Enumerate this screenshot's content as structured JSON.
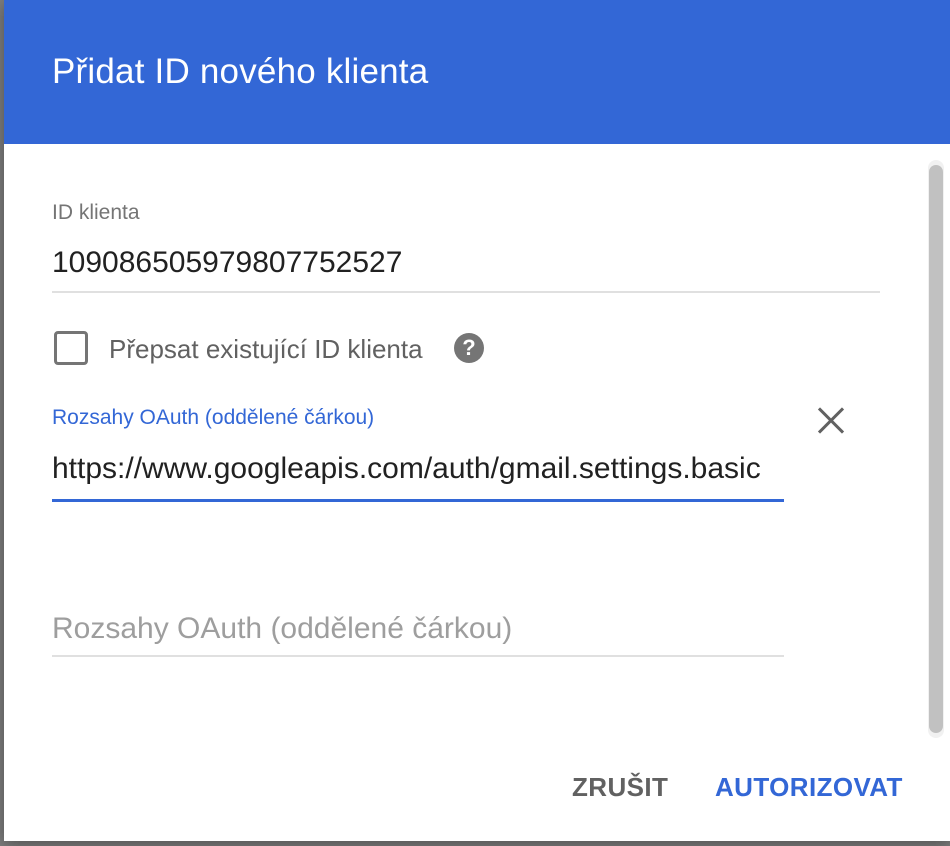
{
  "dialog": {
    "title": "Přidat ID nového klienta"
  },
  "client_id": {
    "label": "ID klienta",
    "value": "109086505979807752527"
  },
  "overwrite": {
    "label": "Přepsat existující ID klienta",
    "checked": false,
    "help_icon": "question-circle-icon"
  },
  "scopes": [
    {
      "label": "Rozsahy OAuth (oddělené čárkou)",
      "value": "https://www.googleapis.com/auth/gmail.settings.basic",
      "remove_icon": "close-icon"
    },
    {
      "placeholder": "Rozsahy OAuth (oddělené čárkou)",
      "value": ""
    }
  ],
  "actions": {
    "cancel": "ZRUŠIT",
    "authorize": "AUTORIZOVAT"
  },
  "colors": {
    "header_bg": "#3367d6",
    "accent": "#3367d6",
    "text_primary": "#212121",
    "text_secondary": "#757575"
  }
}
